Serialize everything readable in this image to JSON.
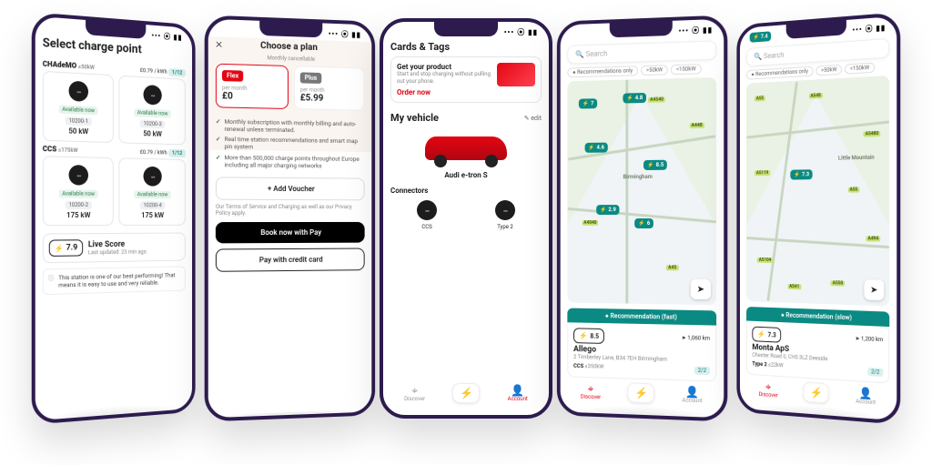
{
  "status": {
    "signal": "••• ⦿ ▮▮"
  },
  "phone1": {
    "title": "Select charge point",
    "sec1": {
      "name": "CHAdeMO",
      "limit": "≤50kW",
      "price": "£0.79 / kWh",
      "count": "1/12"
    },
    "sec2": {
      "name": "CCS",
      "limit": "≤175kW",
      "price": "£0.79 / kWh",
      "count": "1/12"
    },
    "avail": "Available now",
    "cp": [
      {
        "id": "10200-1",
        "power": "50 kW"
      },
      {
        "id": "10200-3",
        "power": "50 kW"
      },
      {
        "id": "10200-2",
        "power": "175 kW"
      },
      {
        "id": "10200-4",
        "power": "175 kW"
      }
    ],
    "live": {
      "score": "7.9",
      "label": "Live Score",
      "updated": "Last updated: 23 min ago"
    },
    "banner": "This station is one of our best performing! That means it is easy to use and very reliable."
  },
  "phone2": {
    "title": "Choose a plan",
    "cancel": "Monthly cancellable",
    "plans": {
      "flex": {
        "name": "Flex",
        "per": "per month",
        "price": "£0"
      },
      "plus": {
        "name": "Plus",
        "per": "per month",
        "price": "£5.99"
      }
    },
    "bullets": [
      "Monthly subscription with monthly billing and auto-renewal unless terminated.",
      "Real time station recommendations and smart map pin system",
      "More than 500,000 charge points throughout Europe including all major charging networks"
    ],
    "voucher": "+ Add Voucher",
    "terms": "Our Terms of Service and Charging as well as our Privacy Policy apply.",
    "applepay": "Book now with  Pay",
    "creditcard": "Pay with credit card"
  },
  "phone3": {
    "cards_title": "Cards & Tags",
    "product": {
      "title": "Get your product",
      "desc": "Start and stop charging without pulling out your phone.",
      "cta": "Order now"
    },
    "vehicle_title": "My vehicle",
    "edit": "edit",
    "vehicle_name": "Audi e-tron S",
    "connectors_title": "Connectors",
    "conn": {
      "ccs": "CCS",
      "type2": "Type 2"
    },
    "nav": {
      "discover": "Discover",
      "account": "Account"
    }
  },
  "phone4": {
    "search": "Search",
    "filters": [
      "● Recommendations only",
      ">50kW",
      "<150kW"
    ],
    "pins": [
      "4.8",
      "8.5",
      "4.6",
      "2.9",
      "7",
      "6"
    ],
    "roads": [
      "A4540",
      "A448",
      "A4040",
      "A45"
    ],
    "city": "Birmingham",
    "reco_label": "● Recommendation (fast)",
    "reco": {
      "score": "8.5",
      "name": "Allego",
      "addr": "2 Timberley Lane, B34 7EH Birmingham",
      "dist": "1,060 km",
      "conn": "CCS",
      "limit": "≤350kW",
      "count": "2/2"
    },
    "nav": {
      "discover": "Discover",
      "account": "Account"
    }
  },
  "phone5": {
    "score_top": "7.4",
    "search": "Search",
    "filters": [
      "● Recommendations only",
      ">50kW",
      "<150kW"
    ],
    "pins": [
      "7.3"
    ],
    "roads": [
      "A55",
      "A548",
      "A5480",
      "A55",
      "A5119",
      "A494",
      "A550",
      "A5104",
      "A541"
    ],
    "place": "Little Mountain",
    "reco_label": "● Recommendation (slow)",
    "reco": {
      "score": "7.3",
      "name": "Monta ApS",
      "addr": "Chester Road 0, CH5 3LZ Deeside",
      "dist": "1,200 km",
      "conn": "Type 2",
      "limit": "≤22kW",
      "count": "2/2"
    },
    "nav": {
      "discover": "Discover",
      "account": "Account"
    }
  }
}
